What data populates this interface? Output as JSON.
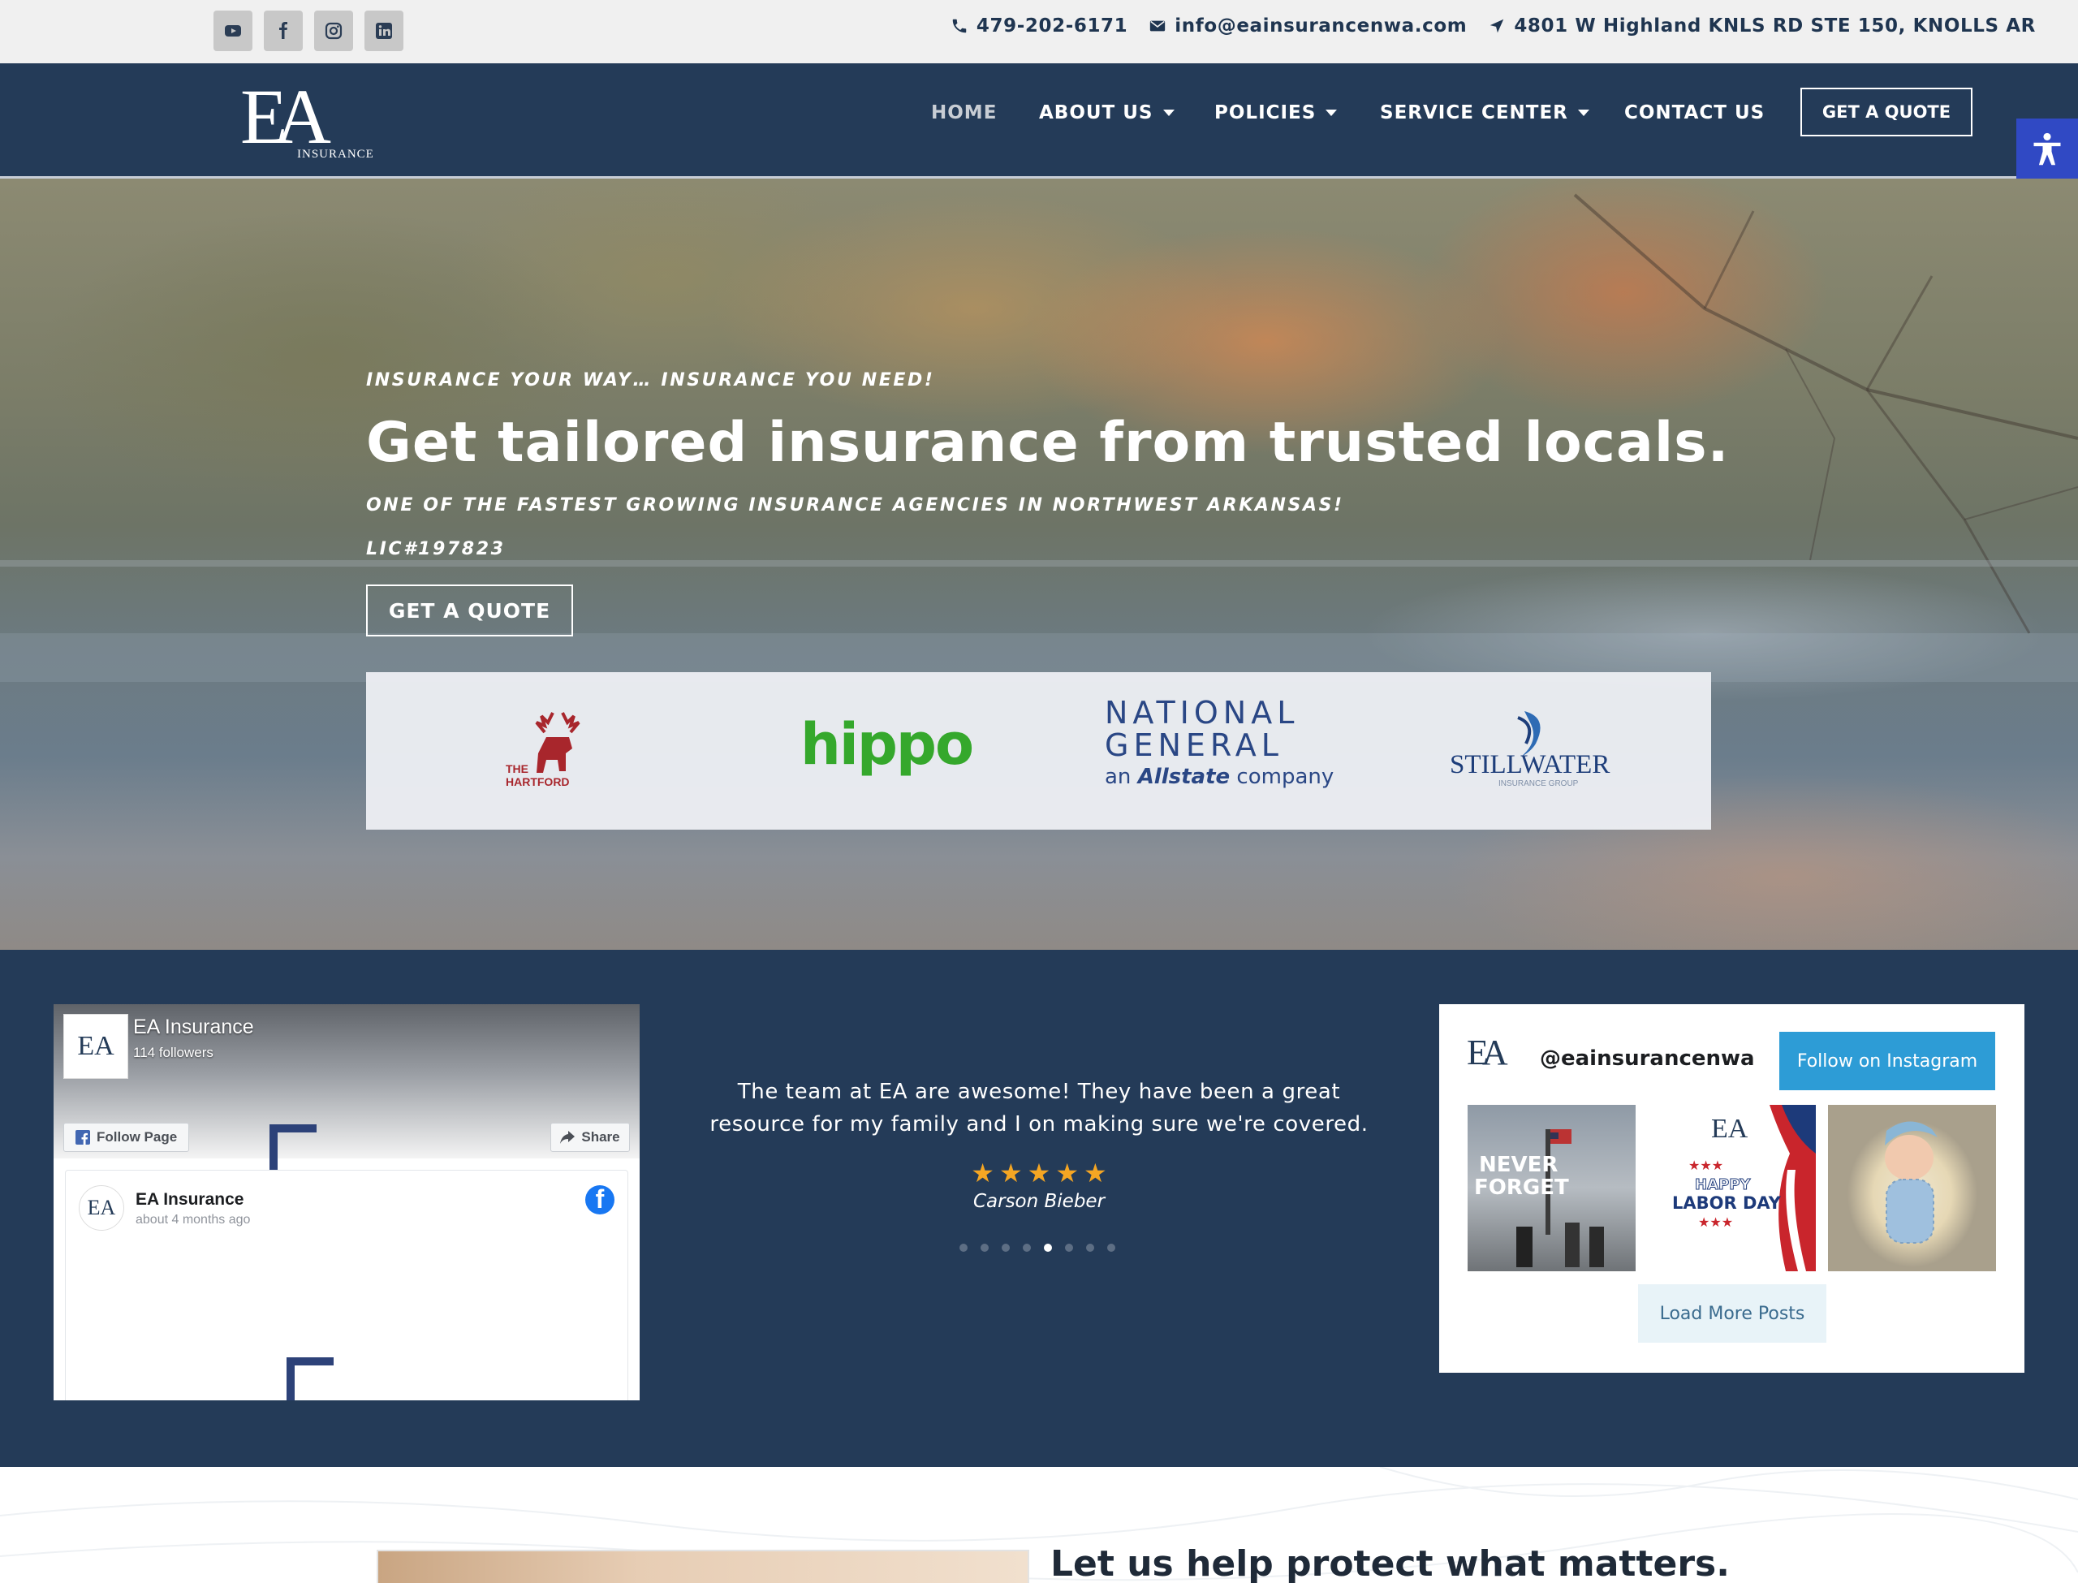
{
  "topbar": {
    "social": [
      {
        "name": "youtube-icon"
      },
      {
        "name": "facebook-icon"
      },
      {
        "name": "instagram-icon"
      },
      {
        "name": "linkedin-icon"
      }
    ],
    "phone": "479-202-6171",
    "email": "info@eainsurancenwa.com",
    "address": "4801 W Highland KNLS RD STE 150, KNOLLS AR"
  },
  "header": {
    "logo_mark": "EA",
    "logo_word": "INSURANCE",
    "nav": [
      {
        "label": "HOME",
        "active": true,
        "dropdown": false
      },
      {
        "label": "ABOUT US",
        "active": false,
        "dropdown": true
      },
      {
        "label": "POLICIES",
        "active": false,
        "dropdown": true
      },
      {
        "label": "SERVICE CENTER",
        "active": false,
        "dropdown": true
      },
      {
        "label": "CONTACT US",
        "active": false,
        "dropdown": false
      }
    ],
    "quote_button": "GET A QUOTE"
  },
  "hero": {
    "tagline": "INSURANCE YOUR WAY… INSURANCE YOU NEED!",
    "title": "Get tailored insurance from trusted locals.",
    "subtitle": "ONE OF THE FASTEST GROWING INSURANCE AGENCIES IN NORTHWEST ARKANSAS!",
    "license": "LIC#197823",
    "cta": "GET A QUOTE",
    "carriers": {
      "hartford_l1": "THE",
      "hartford_l2": "HARTFORD",
      "hippo": "hippo",
      "natgen_l1": "NATIONAL",
      "natgen_l2": "GENERAL",
      "natgen_l3a": "an ",
      "natgen_l3b": "Allstate",
      "natgen_l3c": " company",
      "stillwater": "STILLWATER",
      "stillwater_sub": "INSURANCE GROUP"
    }
  },
  "facebook": {
    "page_name": "EA Insurance",
    "followers": "114 followers",
    "follow_label": "Follow Page",
    "share_label": "Share",
    "post_author": "EA Insurance",
    "post_time": "about 4 months ago",
    "thumb_mark": "EA"
  },
  "review": {
    "text": "The team at EA are awesome! They have been a great resource for my family and I on making sure we're covered.",
    "rating": 5,
    "stars": [
      "★",
      "★",
      "★",
      "★",
      "★"
    ],
    "author": "Carson Bieber",
    "slide_count": 8,
    "active_slide": 5
  },
  "instagram": {
    "handle": "@eainsurancenwa",
    "follow_label": "Follow on Instagram",
    "load_more": "Load More Posts",
    "avatar_mark": "EA",
    "post1_l1": "NEVER",
    "post1_l2": "FORGET",
    "post2_l1": "HAPPY",
    "post2_l2": "LABOR DAY",
    "post2_mark": "EA"
  },
  "bottom": {
    "title": "Let us help protect what matters."
  },
  "colors": {
    "navy": "#243b58",
    "accessibility": "#3049c4",
    "hippo_green": "#35a82c",
    "instagram_button": "#2d9cd6",
    "star": "#f5a623"
  }
}
